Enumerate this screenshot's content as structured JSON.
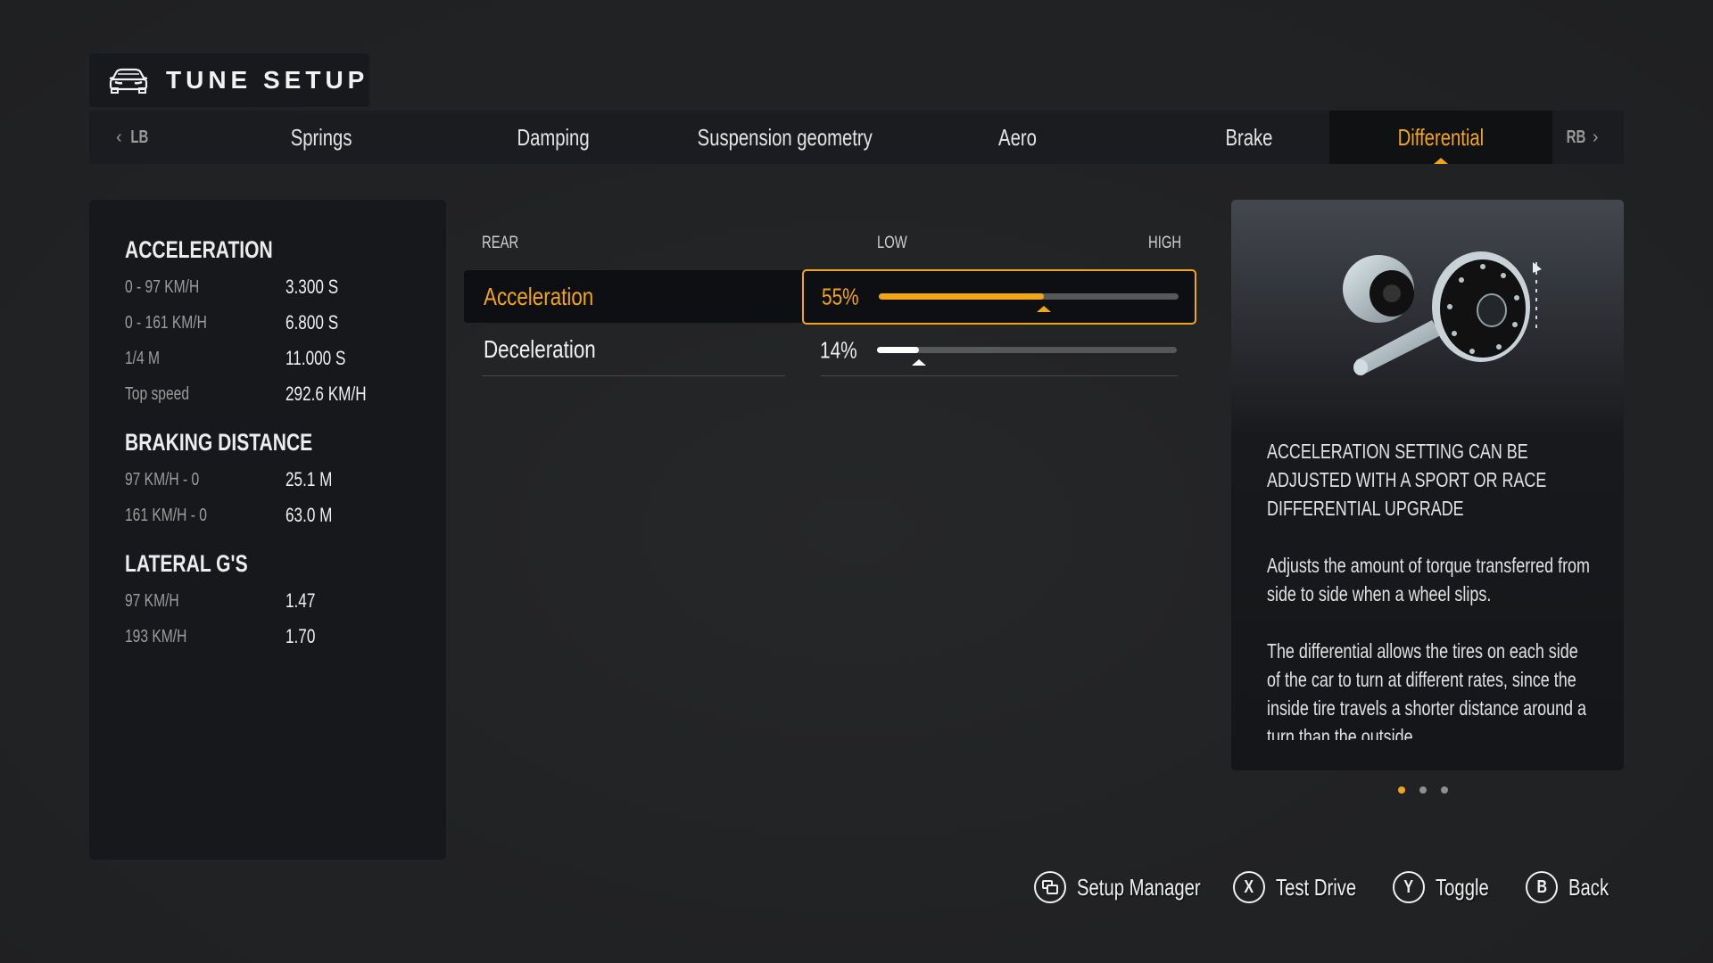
{
  "header": {
    "title": "TUNE SETUP",
    "icon": "car-icon"
  },
  "tabs": {
    "prev_bumper": "LB",
    "next_bumper": "RB",
    "items": [
      {
        "label": "Springs",
        "active": false
      },
      {
        "label": "Damping",
        "active": false
      },
      {
        "label": "Suspension geometry",
        "active": false
      },
      {
        "label": "Aero",
        "active": false
      },
      {
        "label": "Brake",
        "active": false
      },
      {
        "label": "Differential",
        "active": true
      }
    ]
  },
  "stats": {
    "acceleration": {
      "heading": "ACCELERATION",
      "rows": [
        {
          "label": "0 - 97 KM/H",
          "value": "3.300 S"
        },
        {
          "label": "0 - 161 KM/H",
          "value": "6.800 S"
        },
        {
          "label": "1/4 M",
          "value": "11.000 S"
        },
        {
          "label": "Top speed",
          "value": "292.6 KM/H"
        }
      ]
    },
    "braking": {
      "heading": "BRAKING DISTANCE",
      "rows": [
        {
          "label": "97 KM/H - 0",
          "value": "25.1 M"
        },
        {
          "label": "161 KM/H - 0",
          "value": "63.0 M"
        }
      ]
    },
    "lateral": {
      "heading": "LATERAL G'S",
      "rows": [
        {
          "label": "97 KM/H",
          "value": "1.47"
        },
        {
          "label": "193 KM/H",
          "value": "1.70"
        }
      ]
    }
  },
  "settings": {
    "section": "REAR",
    "low_label": "LOW",
    "high_label": "HIGH",
    "rows": [
      {
        "label": "Acceleration",
        "value_text": "55%",
        "value": 0.55,
        "selected": true
      },
      {
        "label": "Deceleration",
        "value_text": "14%",
        "value": 0.14,
        "selected": false
      }
    ]
  },
  "info": {
    "image": "differential-gear-illustration",
    "notice": "ACCELERATION SETTING CAN BE ADJUSTED WITH A SPORT OR RACE DIFFERENTIAL UPGRADE",
    "para1": "Adjusts the amount of torque transferred from side to side when a wheel slips.",
    "para2": "The differential allows the tires on each side of the car to turn at different rates, since the inside tire travels a shorter distance around a turn than the outside",
    "page_count": 3,
    "current_page": 1
  },
  "footer": {
    "hints": [
      {
        "button": "view-icon",
        "glyph": "",
        "label": "Setup Manager"
      },
      {
        "button": "X",
        "glyph": "X",
        "label": "Test Drive"
      },
      {
        "button": "Y",
        "glyph": "Y",
        "label": "Toggle"
      },
      {
        "button": "B",
        "glyph": "B",
        "label": "Back"
      }
    ]
  },
  "colors": {
    "accent": "#f2a516",
    "background": "#222325",
    "panel": "#16181b"
  }
}
